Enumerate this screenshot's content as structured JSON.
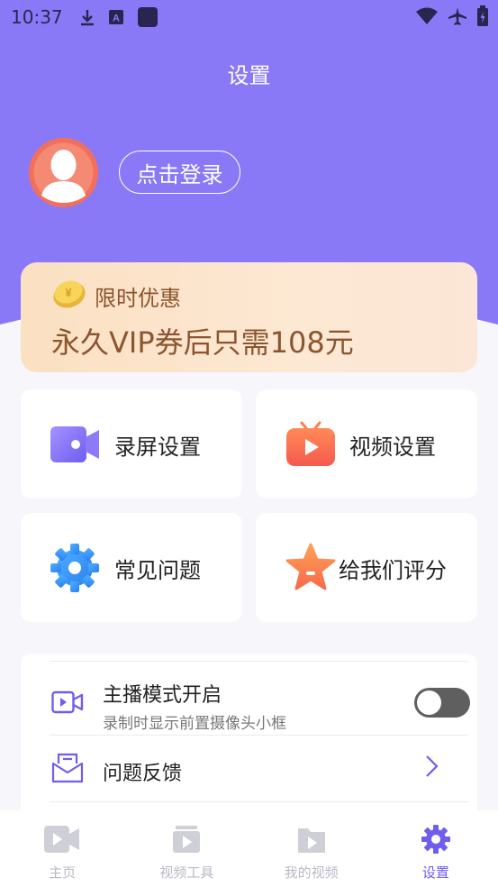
{
  "status_bar": {
    "time": "10:37"
  },
  "header": {
    "title": "设置"
  },
  "profile": {
    "login_label": "点击登录"
  },
  "promo": {
    "tag": "限时优惠",
    "text": "永久VIP券后只需108元"
  },
  "cards": [
    {
      "label": "录屏设置",
      "icon": "screen-record-icon"
    },
    {
      "label": "视频设置",
      "icon": "video-play-icon"
    },
    {
      "label": "常见问题",
      "icon": "gear-icon"
    },
    {
      "label": "给我们评分",
      "icon": "star-icon"
    }
  ],
  "settings": {
    "anchor_mode": {
      "title": "主播模式开启",
      "subtitle": "录制时显示前置摄像头小框",
      "enabled": false
    },
    "feedback": {
      "title": "问题反馈"
    }
  },
  "tabbar": {
    "tabs": [
      {
        "label": "主页",
        "active": false
      },
      {
        "label": "视频工具",
        "active": false
      },
      {
        "label": "我的视频",
        "active": false
      },
      {
        "label": "设置",
        "active": true
      }
    ]
  },
  "colors": {
    "accent": "#8a79f7",
    "active_tab": "#6e5df0",
    "promo_text": "#8b5530"
  }
}
